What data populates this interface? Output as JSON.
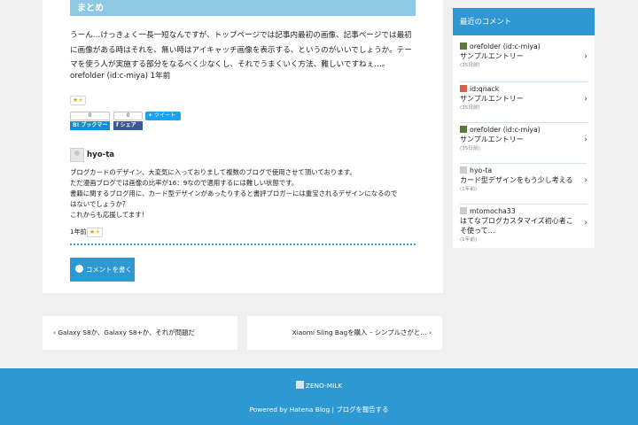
{
  "article": {
    "section_heading": "まとめ",
    "body": "うーん…けっきょく一長一短なんですが、トップページでは記事内最初の画像、記事ページでは最初に画像がある時はそれを、無い時はアイキャッチ画像を表示する、というのがいいでしょうか。テーマを使う人が実施する部分をなるべく少なくし、それでうまくいく方法、難しいですねぇ…。",
    "author_meta": "orefolder (id:c-miya) 1年前",
    "star": "★+"
  },
  "share": {
    "hatena_count": "0",
    "hatena_label": "B! ブックマーク",
    "facebook_count": "0",
    "facebook_label": "f シェア",
    "tweet_label": "ツイート"
  },
  "comment": {
    "user": "hyo-ta",
    "lines": [
      "ブログカードのデザイン、大変気に入っておりまして複数のブログで使用させて頂いております。",
      "ただ漫画ブログでは画像の比率が16：9なので適用するには難しい状態です。",
      "書籍に関するブログ用に、カード型デザインがあったりすると書評ブロガーには重宝されるデザインになるので",
      "はないでしょうか？",
      "これからも応援してます！"
    ],
    "time": "1年前",
    "star": "★+"
  },
  "write_comment": "コメントを書く",
  "nav": {
    "prev": "Galaxy S8か、Galaxy S8+か、それが問題だ",
    "next": "Xiaomi Sling Bagを購入 – シンプルさがと…"
  },
  "sidebar": {
    "title": "最近のコメント",
    "items": [
      {
        "user": "orefolder (id:c-miya)",
        "entry": "サンプルエントリー",
        "date": "(35日前)",
        "avatar_color": "#5a7a3a"
      },
      {
        "user": "id:qnack",
        "entry": "サンプルエントリー",
        "date": "(35日前)",
        "avatar_color": "#d4604a"
      },
      {
        "user": "orefolder (id:c-miya)",
        "entry": "サンプルエントリー",
        "date": "(35日前)",
        "avatar_color": "#5a7a3a"
      },
      {
        "user": "hyo-ta",
        "entry": "カード型デザインをもう少し考える",
        "date": "(1年前)",
        "avatar_color": "#cccccc"
      },
      {
        "user": "mtomocha33",
        "entry": "はてなブログカスタマイズ初心者こそ使って…",
        "date": "(1年前)",
        "avatar_color": "#cccccc"
      }
    ]
  },
  "footer": {
    "blog_name": "ZENO-MILK",
    "credit": "Powered by Hatena Blog | ブログを報告する"
  },
  "colors": {
    "accent": "#2e98d2",
    "section": "#8ec9e4",
    "background": "#f0f0f0"
  }
}
